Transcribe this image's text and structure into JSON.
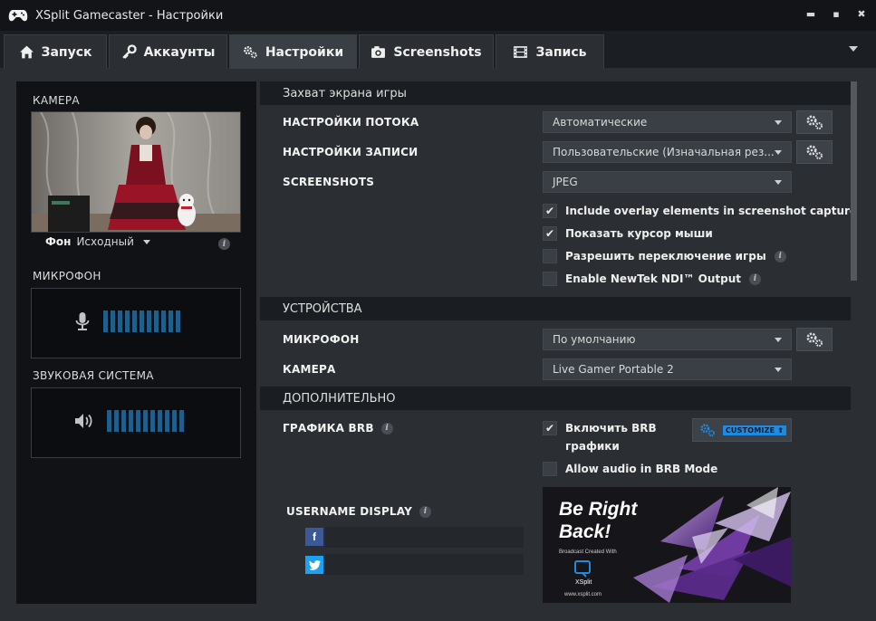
{
  "window": {
    "title": "XSplit Gamecaster - Настройки"
  },
  "tabs": [
    {
      "label": "Запуск",
      "icon": "home-icon"
    },
    {
      "label": "Аккаунты",
      "icon": "key-icon"
    },
    {
      "label": "Настройки",
      "icon": "gears-icon",
      "active": true
    },
    {
      "label": "Screenshots",
      "icon": "camera-icon"
    },
    {
      "label": "Запись",
      "icon": "film-icon"
    }
  ],
  "left": {
    "camera_label": "КАМЕРА",
    "bg_label": "Фон",
    "bg_value": "Исходный",
    "mic_label": "МИКРОФОН",
    "sound_label": "ЗВУКОВАЯ СИСТЕМА"
  },
  "capture": {
    "header": "Захват экрана игры",
    "stream_label": "НАСТРОЙКИ ПОТОКА",
    "stream_value": "Автоматические",
    "record_label": "НАСТРОЙКИ ЗАПИСИ",
    "record_value": "Пользовательские (Изначальная рез...",
    "screenshots_label": "SCREENSHOTS",
    "screenshots_value": "JPEG",
    "checks": [
      {
        "label": "Include overlay elements in screenshot capture",
        "checked": true
      },
      {
        "label": "Показать курсор мыши",
        "checked": true
      },
      {
        "label": "Разрешить переключение игры",
        "checked": false
      },
      {
        "label": "Enable NewTek NDI™ Output",
        "checked": false
      }
    ]
  },
  "devices": {
    "header": "УСТРОЙСТВА",
    "mic_label": "МИКРОФОН",
    "mic_value": "По умолчанию",
    "camera_label": "КАМЕРА",
    "camera_value": "Live Gamer Portable 2"
  },
  "extra": {
    "header": "ДОПОЛНИТЕЛЬНО",
    "brb_label": "ГРАФИКА BRB",
    "brb_enable_line1": "Включить BRB",
    "brb_enable_line2": "графики",
    "brb_enable_checked": true,
    "customize_label": "CUSTOMIZE",
    "allow_audio": "Allow audio in BRB Mode",
    "allow_audio_checked": false,
    "username_label": "USERNAME DISPLAY",
    "facebook_value": "",
    "twitter_value": ""
  },
  "brb_preview": {
    "line1": "Be Right",
    "line2": "Back!",
    "small": "Broadcast Created With",
    "logo": "XSplit",
    "url": "www.xsplit.com"
  },
  "colors": {
    "accent": "#1f8ae0",
    "meter": "#1f5f8c",
    "facebook": "#3b5998",
    "twitter": "#1da1f2"
  }
}
